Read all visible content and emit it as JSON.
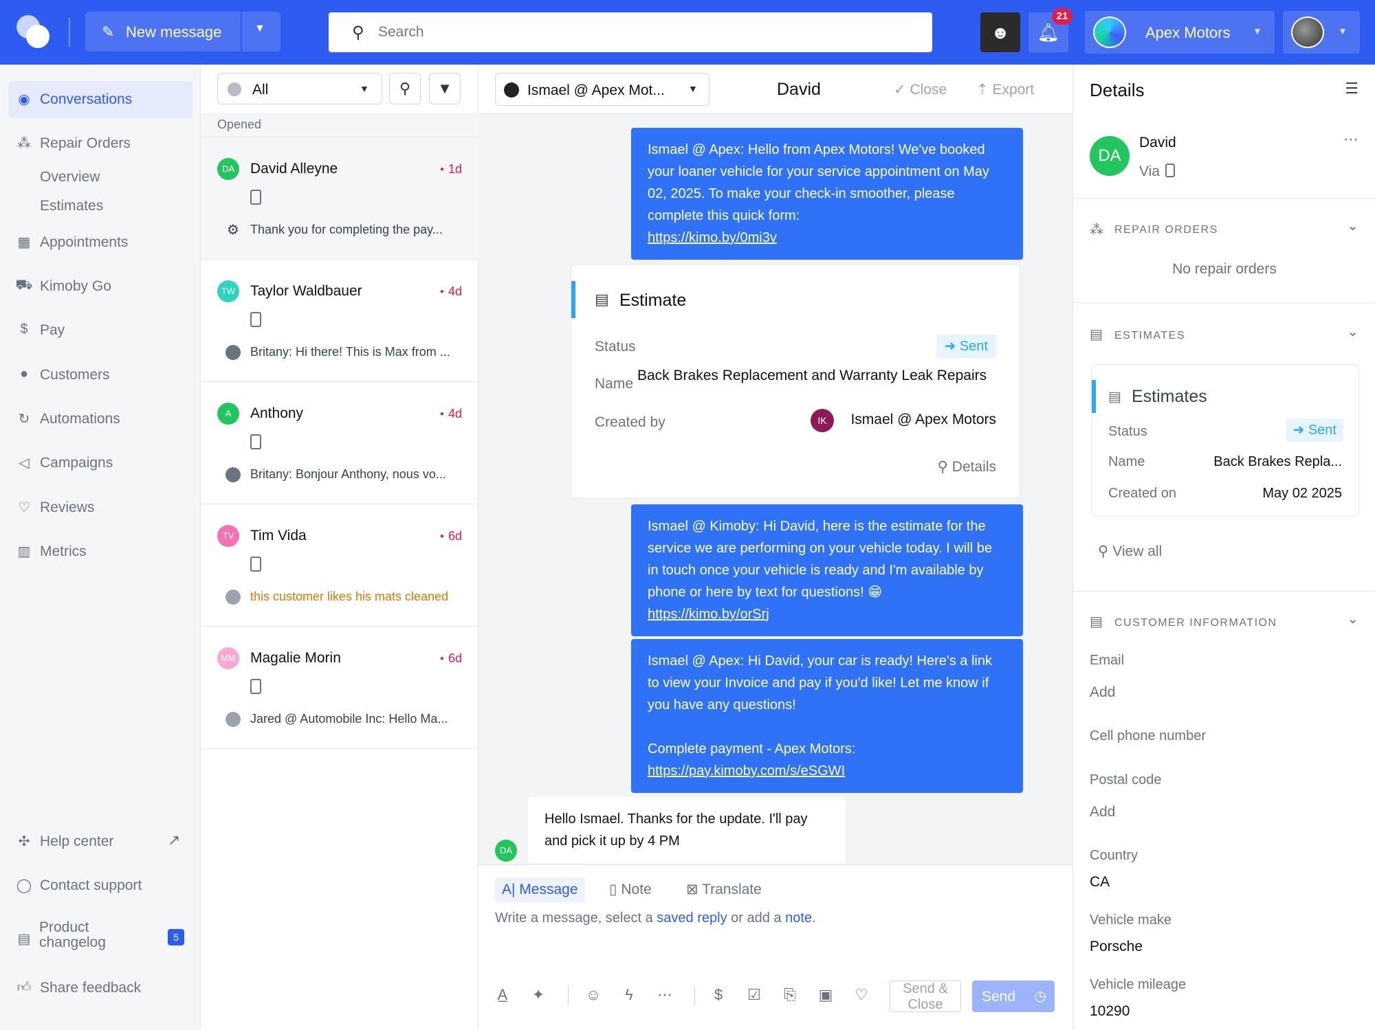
{
  "topbar": {
    "new_message_label": "New message",
    "search_placeholder": "Search",
    "notification_count": "21",
    "org_name": "Apex Motors"
  },
  "sidebar": {
    "items": [
      {
        "label": "Conversations",
        "icon": "chat-bubble-icon"
      },
      {
        "label": "Repair Orders",
        "icon": "repair-orders-icon"
      },
      {
        "label": "Overview"
      },
      {
        "label": "Estimates"
      },
      {
        "label": "Appointments",
        "icon": "calendar-icon"
      },
      {
        "label": "Kimoby Go",
        "icon": "car-icon"
      },
      {
        "label": "Pay",
        "icon": "dollar-icon"
      },
      {
        "label": "Customers",
        "icon": "person-icon"
      },
      {
        "label": "Automations",
        "icon": "automation-icon"
      },
      {
        "label": "Campaigns",
        "icon": "megaphone-icon"
      },
      {
        "label": "Reviews",
        "icon": "heart-icon"
      },
      {
        "label": "Metrics",
        "icon": "bar-chart-icon"
      }
    ],
    "footer": {
      "help_center": "Help center",
      "contact_support": "Contact support",
      "product_changelog_1": "Product",
      "product_changelog_2": "changelog",
      "changelog_badge": "5",
      "share_feedback": "Share feedback"
    }
  },
  "convlist": {
    "filter_value": "All",
    "section_label": "Opened",
    "conversations": [
      {
        "initials": "DA",
        "name": "David Alleyne",
        "time": "1d",
        "preview": "Thank you for completing the pay...",
        "avatar_color": "#22c55e"
      },
      {
        "initials": "TW",
        "name": "Taylor Waldbauer",
        "time": "4d",
        "preview": "Britany: Hi there! This is Max from ...",
        "avatar_color": "#2dd4bf"
      },
      {
        "initials": "A",
        "name": "Anthony",
        "time": "4d",
        "preview": "Britany: Bonjour Anthony, nous vo...",
        "avatar_color": "#22c55e"
      },
      {
        "initials": "TV",
        "name": "Tim Vida",
        "time": "6d",
        "preview": "this customer likes his mats cleaned",
        "avatar_color": "#f472b6"
      },
      {
        "initials": "MM",
        "name": "Magalie Morin",
        "time": "6d",
        "preview": "Jared @ Automobile Inc: Hello Ma...",
        "avatar_color": "#f9a8d4"
      }
    ]
  },
  "chat": {
    "agent": "Ismael @ Apex Mot...",
    "title": "David",
    "close_label": "Close",
    "export_label": "Export",
    "msg1_text": "Ismael @ Apex: Hello from Apex Motors! We've booked your loaner vehicle for your service appointment on May 02, 2025. To make your check-in smoother, please complete this quick form:",
    "msg1_link": "https://kimo.by/0mi3v",
    "estimate": {
      "title": "Estimate",
      "status_label": "Status",
      "status_value": "Sent",
      "name_label": "Name",
      "name_value": "Back Brakes Replacement and Warranty Leak Repairs",
      "created_by_label": "Created by",
      "created_by_initials": "IK",
      "created_by_value": "Ismael @ Apex Motors",
      "details_label": "Details"
    },
    "msg2_text": "Ismael @ Kimoby: Hi David, here is the estimate for the service we are performing on your vehicle today. I will be in touch once your vehicle is ready and I'm available by phone or here by text for questions! 😁",
    "msg2_link": "https://kimo.by/orSrj",
    "msg3_text": "Ismael @ Apex: Hi David, your car is ready! Here's a link to view your Invoice and pay if you'd like! Let me know if you have any questions!",
    "msg3_text2": "Complete payment - Apex Motors:",
    "msg3_link": "https://pay.kimoby.com/s/eSGWI",
    "msg4_text": "Hello Ismael. Thanks for the update. I'll pay and pick it up by 4 PM",
    "msg4_initials": "DA"
  },
  "composer": {
    "tab_message": "Message",
    "tab_note": "Note",
    "tab_translate": "Translate",
    "ph_1": "Write a message, select a ",
    "ph_saved": "saved reply",
    "ph_2": " or add a ",
    "ph_note": "note",
    "ph_3": ".",
    "send_close_1": "Send &",
    "send_close_2": "Close",
    "send_label": "Send"
  },
  "details": {
    "heading": "Details",
    "initials": "DA",
    "name": "David",
    "via": "Via",
    "repair_orders_heading": "REPAIR ORDERS",
    "no_repair_orders": "No repair orders",
    "estimates_heading": "ESTIMATES",
    "estimates_card": {
      "title": "Estimates",
      "status_label": "Status",
      "status_value": "Sent",
      "name_label": "Name",
      "name_value": "Back Brakes Repla...",
      "created_label": "Created on",
      "created_value": "May 02 2025"
    },
    "view_all": "View all",
    "customer_info_heading": "CUSTOMER INFORMATION",
    "email_label": "Email",
    "email_add": "Add",
    "cell_label": "Cell phone number",
    "postal_label": "Postal code",
    "postal_add": "Add",
    "country_label": "Country",
    "country_value": "CA",
    "make_label": "Vehicle make",
    "make_value": "Porsche",
    "mileage_label": "Vehicle mileage",
    "mileage_value": "10290"
  },
  "colors": {
    "brand": "#2f5cf0",
    "outgoing_bubble": "#2f72f5",
    "status_sent": "#2ba7f5",
    "unread": "#e11d48"
  }
}
